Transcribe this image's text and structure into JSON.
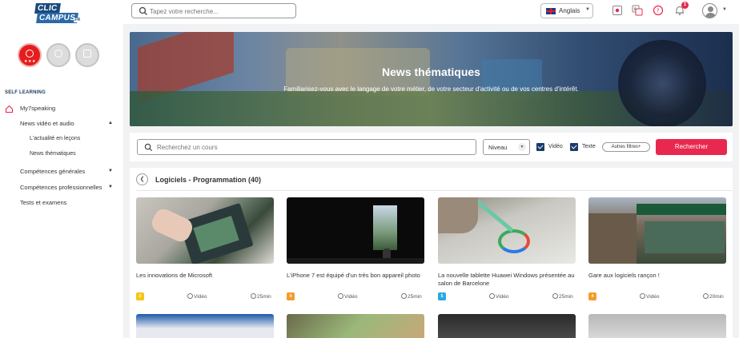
{
  "header": {
    "logo_line1": "CLIC",
    "logo_line2": "CAMPUS",
    "logo_suffix": ".FR",
    "search_placeholder": "Tapez votre recherche...",
    "language": "Anglais",
    "notification_count": "1"
  },
  "sidebar": {
    "section_title": "SELF LEARNING",
    "items": [
      {
        "label": "My7speaking"
      },
      {
        "label": "News vidéo et audio"
      },
      {
        "label": "L'actualité en leçons"
      },
      {
        "label": "News thématiques"
      },
      {
        "label": "Compétences générales"
      },
      {
        "label": "Compétences professionnelles"
      },
      {
        "label": "Tests et examens"
      }
    ],
    "medal_stars": "★★★"
  },
  "banner": {
    "title": "News thématiques",
    "subtitle": "Familiarisez-vous avec le langage de votre métier, de votre secteur d'activité ou de vos centres d'intérêt."
  },
  "filters": {
    "search_placeholder": "Recherchez un cours",
    "niveau_label": "Niveau",
    "video_label": "Vidéo",
    "texte_label": "Texte",
    "autres_label": "Autres filtres+",
    "rechercher_label": "Rechercher"
  },
  "category": {
    "title": "Logiciels - Programmation (40)"
  },
  "cards": [
    {
      "title": "Les innovations de Microsoft",
      "level": "2",
      "level_color": "#f5c518",
      "type": "Vidéo",
      "duration": "25min"
    },
    {
      "title": "L'iPhone 7 est équipé d'un très bon appareil photo",
      "level": "4",
      "level_color": "#f39c2d",
      "type": "Vidéo",
      "duration": "25min"
    },
    {
      "title": "La nouvelle tablette Huawei Windows présentée au salon de Barcelone",
      "level": "5",
      "level_color": "#29a9e1",
      "type": "Vidéo",
      "duration": "25min"
    },
    {
      "title": "Gare aux logiciels rançon !",
      "level": "4",
      "level_color": "#f39c2d",
      "type": "Vidéo",
      "duration": "20min"
    }
  ],
  "colors": {
    "accent": "#e8284f",
    "navy": "#1a3a6a",
    "medal_active": "#e61d1d"
  }
}
